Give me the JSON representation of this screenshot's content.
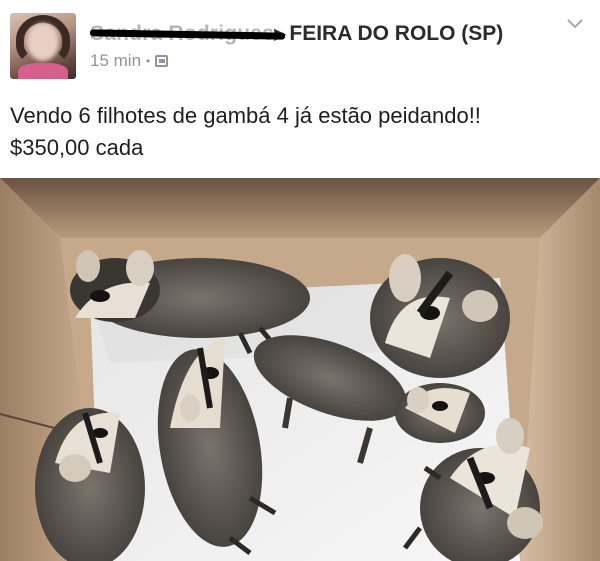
{
  "post": {
    "author_name": "Sandra Rodrigues",
    "arrow": "▶",
    "group_name": "FEIRA DO ROLO (SP)",
    "timestamp": "15 min",
    "separator": "•",
    "privacy_icon": "friends-icon",
    "menu_icon": "chevron-down-icon",
    "text_line1": "Vendo 6 filhotes de gambá 4 já estão peidando!!",
    "text_line2": "$350,00 cada",
    "photo": {
      "subject": "six opossum babies in a cardboard box",
      "colors": {
        "box": "#c9ad90",
        "box_dark": "#7d6450",
        "paper": "#f2f2f2",
        "fur": "#5a5650"
      }
    }
  }
}
